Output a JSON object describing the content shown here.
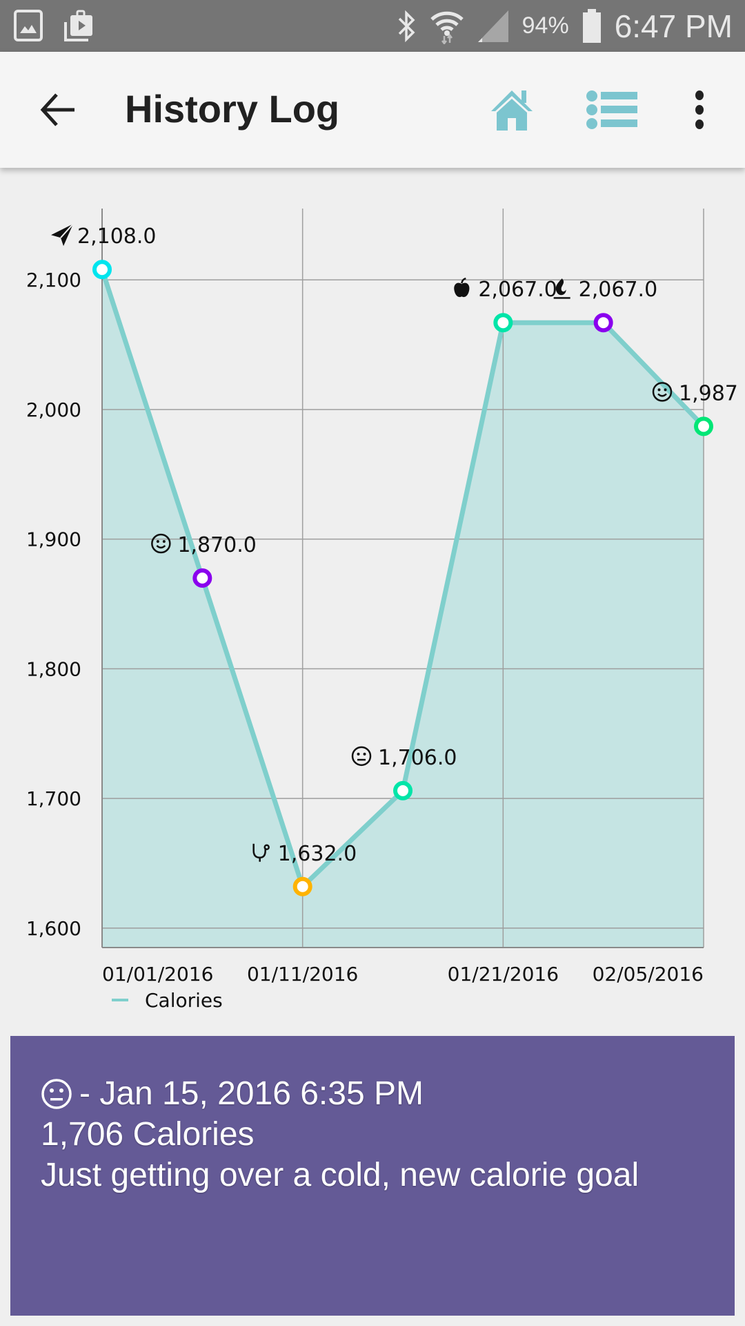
{
  "status_bar": {
    "left_icons": [
      "gallery-icon",
      "media-share-icon"
    ],
    "right_icons": [
      "bluetooth-icon",
      "wifi-icon",
      "signal-icon",
      "battery-icon"
    ],
    "battery": "94%",
    "time": "6:47 PM"
  },
  "app_bar": {
    "title": "History Log",
    "back_icon": "arrow-back-icon",
    "actions": [
      "home-icon",
      "list-icon",
      "more-vert-icon"
    ],
    "accent": "#7cc5cf"
  },
  "chart_data": {
    "type": "area",
    "title": "",
    "xlabel": "",
    "ylabel": "",
    "ylim": [
      1585,
      2155
    ],
    "yticks": [
      1600,
      1700,
      1800,
      1900,
      2000,
      2100
    ],
    "ytick_labels": [
      "1,600",
      "1,700",
      "1,800",
      "1,900",
      "2,000",
      "2,100"
    ],
    "xtick_labels": [
      {
        "index": 0,
        "label": "01/01/2016"
      },
      {
        "index": 2,
        "label": "01/11/2016"
      },
      {
        "index": 4,
        "label": "01/21/2016"
      },
      {
        "index": 6,
        "label": "02/05/2016"
      }
    ],
    "grid": true,
    "legend": {
      "position": "bottom-left",
      "entries": [
        {
          "name": "Calories",
          "color": "#7fcfcc"
        }
      ]
    },
    "series": [
      {
        "name": "Calories",
        "line_color": "#7fcfcc",
        "fill_color": "#c5e4e3",
        "points": [
          {
            "index": 0,
            "value": 2108.0,
            "label": "2,108.0",
            "icon": "paper-plane-icon",
            "marker_color": "#00e5ee"
          },
          {
            "index": 1,
            "value": 1870.0,
            "label": "1,870.0",
            "icon": "smile-icon",
            "marker_color": "#8a00ee"
          },
          {
            "index": 2,
            "value": 1632.0,
            "label": "1,632.0",
            "icon": "stethoscope-icon",
            "marker_color": "#ffb300"
          },
          {
            "index": 3,
            "value": 1706.0,
            "label": "1,706.0",
            "icon": "neutral-face-icon",
            "marker_color": "#00e5a8"
          },
          {
            "index": 4,
            "value": 2067.0,
            "label": "2,067.0",
            "icon": "apple-icon",
            "marker_color": "#00e5a8"
          },
          {
            "index": 5,
            "value": 2067.0,
            "label": "2,067.0",
            "icon": "flame-icon",
            "marker_color": "#8a00ee"
          },
          {
            "index": 6,
            "value": 1987.0,
            "label": "1,987",
            "icon": "smile-icon",
            "marker_color": "#00e676"
          }
        ]
      }
    ]
  },
  "detail": {
    "mood_icon": "neutral-face-icon",
    "datetime": "- Jan 15, 2016 6:35 PM",
    "calories": "1,706 Calories",
    "note": "Just getting over a cold, new calorie goal",
    "background": "#645a96"
  }
}
